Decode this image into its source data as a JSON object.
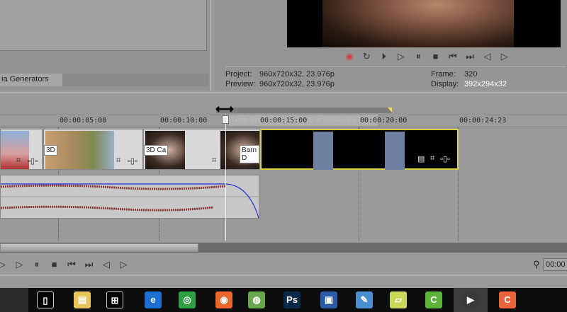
{
  "left_panel": {
    "tab_label": "ia Generators"
  },
  "preview": {
    "transport": [
      {
        "icon": "record-icon",
        "glyph": "◉"
      },
      {
        "icon": "loop-icon",
        "glyph": "↻"
      },
      {
        "icon": "play-from-start-icon",
        "glyph": "⏵"
      },
      {
        "icon": "play-icon",
        "glyph": "▷"
      },
      {
        "icon": "pause-icon",
        "glyph": "⏸"
      },
      {
        "icon": "stop-icon",
        "glyph": "■"
      },
      {
        "icon": "prev-marker-icon",
        "glyph": "⏮"
      },
      {
        "icon": "next-marker-icon",
        "glyph": "⏭"
      },
      {
        "icon": "prev-frame-icon",
        "glyph": "◁"
      },
      {
        "icon": "next-frame-icon",
        "glyph": "▷"
      }
    ],
    "project_label": "Project:",
    "project_value": "960x720x32, 23.976p",
    "preview_label": "Preview:",
    "preview_value": "960x720x32, 23.976p",
    "frame_label": "Frame:",
    "frame_value": "320",
    "display_label": "Display:",
    "display_value": "392x294x32"
  },
  "timeline": {
    "ruler": [
      "00:00:05:00",
      "00:00:10:00",
      "00:00:15:00",
      "00:00:20:00",
      "00:00:24:23"
    ],
    "loop_tooltip": "Loop Region: 00:00:13:08 to 00:00:24:23",
    "transitions": [
      "3D",
      "3D Ca",
      "Barn D"
    ],
    "time_value": "00:00"
  },
  "bottom_transport": [
    {
      "icon": "play-from-start-icon",
      "glyph": "▷"
    },
    {
      "icon": "play-icon",
      "glyph": "▷"
    },
    {
      "icon": "pause-icon",
      "glyph": "⏸"
    },
    {
      "icon": "stop-icon",
      "glyph": "■"
    },
    {
      "icon": "prev-marker-icon",
      "glyph": "⏮"
    },
    {
      "icon": "next-marker-icon",
      "glyph": "⏭"
    },
    {
      "icon": "prev-frame-icon",
      "glyph": "◁"
    },
    {
      "icon": "next-frame-icon",
      "glyph": "▷"
    }
  ],
  "taskbar": [
    {
      "name": "task-view",
      "glyph": "▯",
      "color": "#000"
    },
    {
      "name": "file-explorer",
      "glyph": "▤",
      "color": "#e8c45a"
    },
    {
      "name": "store",
      "glyph": "⊞",
      "color": "#000"
    },
    {
      "name": "edge",
      "glyph": "e",
      "color": "#1e6fd0"
    },
    {
      "name": "chrome",
      "glyph": "◎",
      "color": "#2f9e44"
    },
    {
      "name": "firefox",
      "glyph": "◉",
      "color": "#e8672a"
    },
    {
      "name": "app-green",
      "glyph": "◍",
      "color": "#6aa84f"
    },
    {
      "name": "photoshop",
      "glyph": "Ps",
      "color": "#0b2a4a"
    },
    {
      "name": "network",
      "glyph": "▣",
      "color": "#2a5aa8"
    },
    {
      "name": "paint",
      "glyph": "✎",
      "color": "#4a8fd0"
    },
    {
      "name": "sticky",
      "glyph": "▱",
      "color": "#c9d85a"
    },
    {
      "name": "camtasia-recorder",
      "glyph": "C",
      "color": "#5db33a"
    },
    {
      "name": "vegas",
      "glyph": "▶",
      "color": "#3a3a3a"
    },
    {
      "name": "camtasia",
      "glyph": "C",
      "color": "#e8643a"
    }
  ]
}
